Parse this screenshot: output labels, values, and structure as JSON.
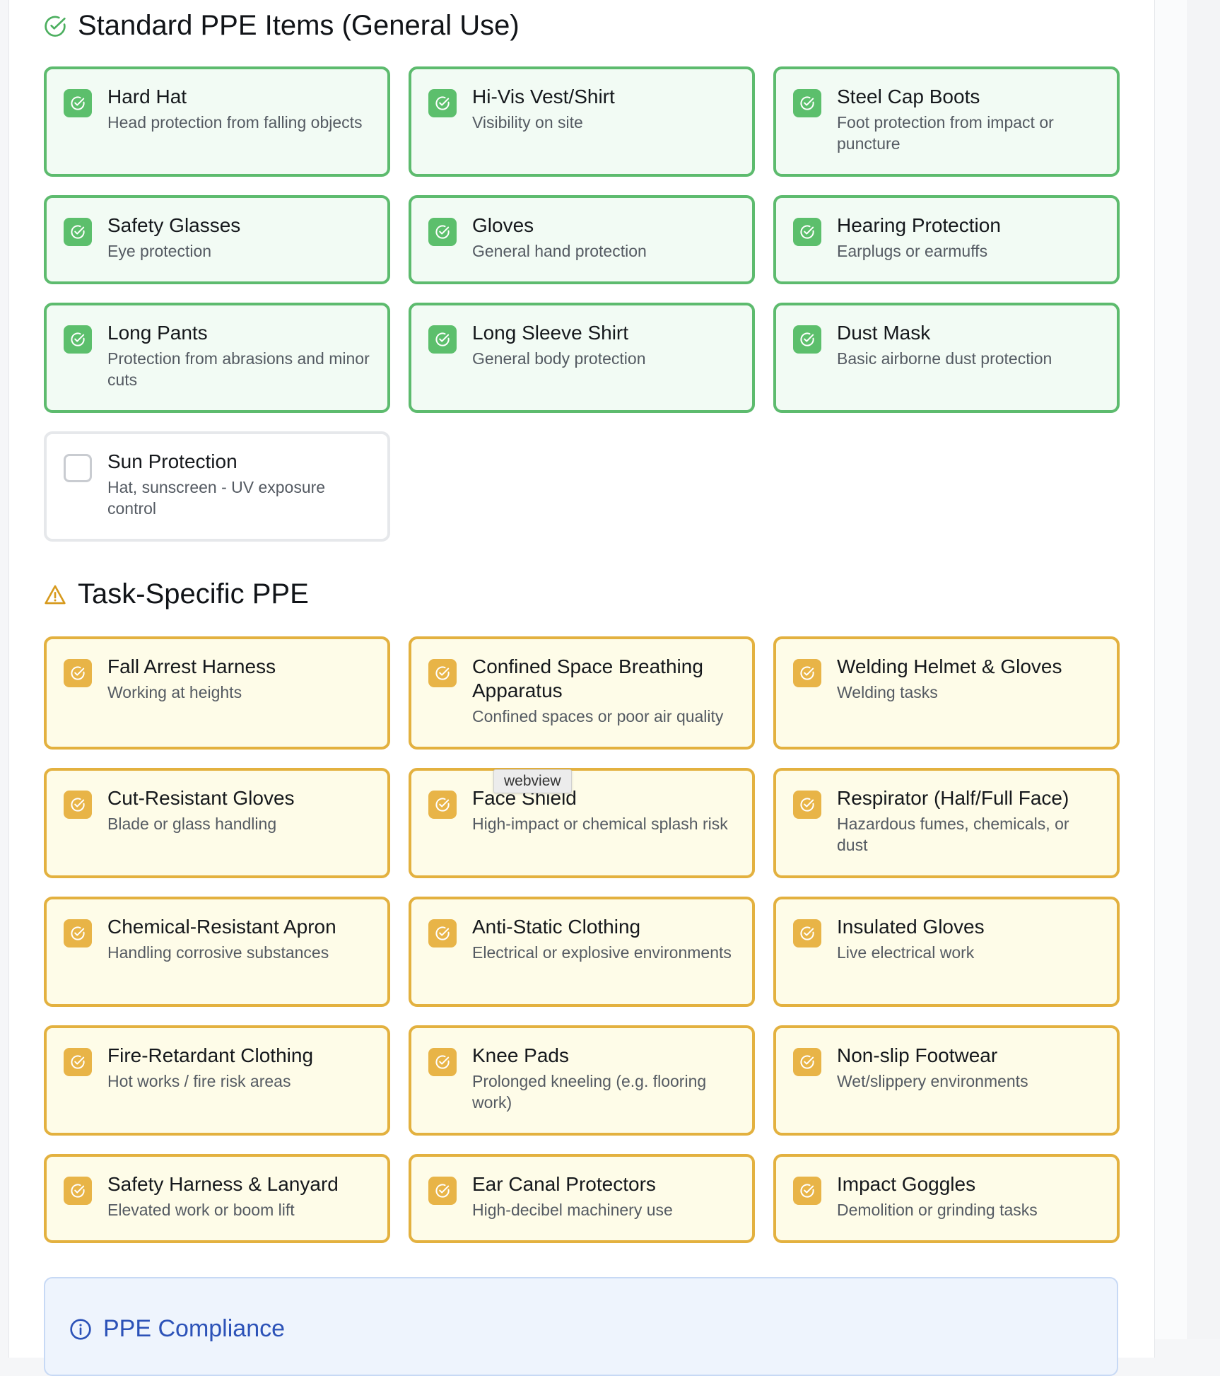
{
  "standard_section": {
    "title": "Standard PPE Items (General Use)",
    "items": [
      {
        "title": "Hard Hat",
        "desc": "Head protection from falling objects",
        "checked": true
      },
      {
        "title": "Hi-Vis Vest/Shirt",
        "desc": "Visibility on site",
        "checked": true
      },
      {
        "title": "Steel Cap Boots",
        "desc": "Foot protection from impact or puncture",
        "checked": true
      },
      {
        "title": "Safety Glasses",
        "desc": "Eye protection",
        "checked": true
      },
      {
        "title": "Gloves",
        "desc": "General hand protection",
        "checked": true
      },
      {
        "title": "Hearing Protection",
        "desc": "Earplugs or earmuffs",
        "checked": true
      },
      {
        "title": "Long Pants",
        "desc": "Protection from abrasions and minor cuts",
        "checked": true
      },
      {
        "title": "Long Sleeve Shirt",
        "desc": "General body protection",
        "checked": true
      },
      {
        "title": "Dust Mask",
        "desc": "Basic airborne dust protection",
        "checked": true
      },
      {
        "title": "Sun Protection",
        "desc": "Hat, sunscreen - UV exposure control",
        "checked": false
      }
    ]
  },
  "task_section": {
    "title": "Task-Specific PPE",
    "items": [
      {
        "title": "Fall Arrest Harness",
        "desc": "Working at heights",
        "checked": true
      },
      {
        "title": "Confined Space Breathing Apparatus",
        "desc": "Confined spaces or poor air quality",
        "checked": true
      },
      {
        "title": "Welding Helmet & Gloves",
        "desc": "Welding tasks",
        "checked": true
      },
      {
        "title": "Cut-Resistant Gloves",
        "desc": "Blade or glass handling",
        "checked": true
      },
      {
        "title": "Face Shield",
        "desc": "High-impact or chemical splash risk",
        "checked": true
      },
      {
        "title": "Respirator (Half/Full Face)",
        "desc": "Hazardous fumes, chemicals, or dust",
        "checked": true
      },
      {
        "title": "Chemical-Resistant Apron",
        "desc": "Handling corrosive substances",
        "checked": true
      },
      {
        "title": "Anti-Static Clothing",
        "desc": "Electrical or explosive environments",
        "checked": true
      },
      {
        "title": "Insulated Gloves",
        "desc": "Live electrical work",
        "checked": true
      },
      {
        "title": "Fire-Retardant Clothing",
        "desc": "Hot works / fire risk areas",
        "checked": true
      },
      {
        "title": "Knee Pads",
        "desc": "Prolonged kneeling (e.g. flooring work)",
        "checked": true
      },
      {
        "title": "Non-slip Footwear",
        "desc": "Wet/slippery environments",
        "checked": true
      },
      {
        "title": "Safety Harness & Lanyard",
        "desc": "Elevated work or boom lift",
        "checked": true
      },
      {
        "title": "Ear Canal Protectors",
        "desc": "High-decibel machinery use",
        "checked": true
      },
      {
        "title": "Impact Goggles",
        "desc": "Demolition or grinding tasks",
        "checked": true
      }
    ]
  },
  "compliance": {
    "title": "PPE Compliance"
  },
  "tooltip": {
    "text": "webview"
  },
  "colors": {
    "standard_accent": "#5cbf6c",
    "task_accent": "#e8b447",
    "info_accent": "#2c52b8"
  },
  "icons": {
    "standard_header": "check-circle-icon",
    "task_header": "warning-triangle-icon",
    "compliance_header": "info-icon",
    "card_check": "check-circle-icon"
  }
}
